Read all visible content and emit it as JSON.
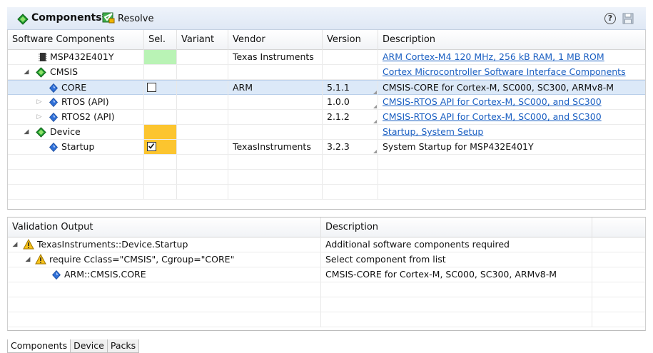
{
  "header": {
    "title": "Components*",
    "resolve_label": "Resolve",
    "help_glyph": "?",
    "icons": [
      "green-diamond-icon",
      "resolve-icon",
      "help-icon",
      "save-icon"
    ]
  },
  "components": {
    "columns": [
      "Software Components",
      "Sel.",
      "Variant",
      "Vendor",
      "Version",
      "Description"
    ],
    "rows": [
      {
        "name": "MSP432E401Y",
        "vendor": "Texas Instruments",
        "version": "",
        "description": "ARM Cortex-M4 120 MHz, 256 kB RAM, 1 MB ROM",
        "icon": "chip-icon"
      },
      {
        "name": "CMSIS",
        "vendor": "",
        "version": "",
        "description": "Cortex Microcontroller Software Interface Components",
        "icon": "green-diamond-icon",
        "expanded": true
      },
      {
        "name": "CORE",
        "vendor": "ARM",
        "version": "5.1.1",
        "description": "CMSIS-CORE for Cortex-M, SC000, SC300, ARMv8-M",
        "icon": "blue-diamond-icon",
        "selected_row": true,
        "checked": false
      },
      {
        "name": "RTOS (API)",
        "vendor": "",
        "version": "1.0.0",
        "description": "CMSIS-RTOS API for Cortex-M, SC000, and SC300",
        "icon": "blue-diamond-icon",
        "expanded": false
      },
      {
        "name": "RTOS2 (API)",
        "vendor": "",
        "version": "2.1.2",
        "description": "CMSIS-RTOS API for Cortex-M, SC000, and SC300",
        "icon": "blue-diamond-icon",
        "expanded": false
      },
      {
        "name": "Device",
        "vendor": "",
        "version": "",
        "description": "Startup, System Setup",
        "icon": "green-diamond-icon",
        "expanded": true
      },
      {
        "name": "Startup",
        "vendor": "TexasInstruments",
        "version": "3.2.3",
        "description": "System Startup for MSP432E401Y",
        "icon": "blue-diamond-icon",
        "checked": true
      }
    ],
    "colors": {
      "sel_ok": "#b9f3b5",
      "sel_warning": "#fcc52f",
      "link": "#1a5fc2",
      "selection": "#dce9f8"
    }
  },
  "validation": {
    "columns": [
      "Validation Output",
      "Description"
    ],
    "rows": [
      {
        "text": "TexasInstruments::Device.Startup",
        "description": "Additional software components required",
        "icon": "warning-icon"
      },
      {
        "text": "require Cclass=\"CMSIS\", Cgroup=\"CORE\"",
        "description": "Select component from list",
        "icon": "warning-icon"
      },
      {
        "text": "ARM::CMSIS.CORE",
        "description": "CMSIS-CORE for Cortex-M, SC000, SC300, ARMv8-M",
        "icon": "blue-diamond-icon"
      }
    ]
  },
  "tabs": [
    {
      "label": "Components",
      "active": true
    },
    {
      "label": "Device",
      "active": false
    },
    {
      "label": "Packs",
      "active": false
    }
  ]
}
